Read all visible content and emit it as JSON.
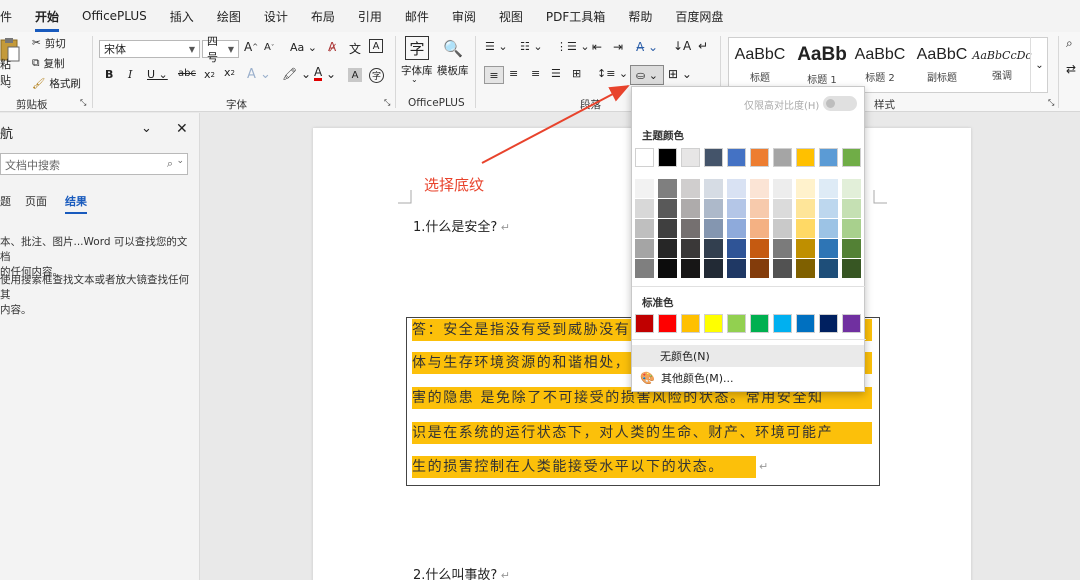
{
  "menu": {
    "items": [
      "件",
      "开始",
      "OfficePLUS",
      "插入",
      "绘图",
      "设计",
      "布局",
      "引用",
      "邮件",
      "审阅",
      "视图",
      "PDF工具箱",
      "帮助",
      "百度网盘"
    ]
  },
  "ribbon": {
    "clipboard": {
      "paste": "粘贴",
      "cut": "剪切",
      "copy": "复制",
      "format_painter": "格式刷",
      "label": "剪贴板"
    },
    "font": {
      "name": "宋体",
      "size": "四号",
      "label": "字体"
    },
    "officeplus": {
      "font_lib": "字体库",
      "template_lib": "模板库",
      "label": "OfficePLUS"
    },
    "paragraph": {
      "label": "段落"
    },
    "styles": {
      "label": "样式",
      "items": [
        {
          "sample": "AaBbC",
          "name": "标题"
        },
        {
          "sample": "AaBb",
          "name": "标题 1"
        },
        {
          "sample": "AaBbC",
          "name": "标题 2"
        },
        {
          "sample": "AaBbC",
          "name": "副标题"
        },
        {
          "sample": "AaBbCcDc",
          "name": "强调"
        }
      ]
    }
  },
  "nav": {
    "title": "航",
    "search_placeholder": "文档中搜索",
    "tabs": [
      "题",
      "页面",
      "结果"
    ],
    "text1": [
      "本、批注、图片...Word 可以查找您的文档",
      "的任何内容。"
    ],
    "text2": [
      "使用搜索框查找文本或者放大镜查找任何其",
      "内容。"
    ]
  },
  "doc": {
    "q1": "1.什么是安全?",
    "answer_lines": [
      "答：安全是指没有受到威胁没有危险、危害、损失。人类的整",
      "体与生存环境资源的和谐相处，互相不伤害，不存在危险、危",
      "害的隐患  是免除了不可接受的损害风险的状态。常用安全知",
      "识是在系统的运行状态下，对人类的生命、财产、环境可能产",
      "生的损害控制在人类能接受水平以下的状态。"
    ],
    "q2": "2.什么叫事故?"
  },
  "annotation": {
    "text": "选择底纹"
  },
  "shading_dropdown": {
    "contrast_label": "仅限高对比度(H)",
    "theme_label": "主题颜色",
    "standard_label": "标准色",
    "no_color": "无颜色(N)",
    "more_colors": "其他颜色(M)...",
    "theme_top": [
      "#ffffff",
      "#000000",
      "#e7e6e6",
      "#44546a",
      "#4472c4",
      "#ed7d31",
      "#a5a5a5",
      "#ffc000",
      "#5b9bd5",
      "#70ad47"
    ],
    "theme_shades": [
      [
        "#f2f2f2",
        "#7f7f7f",
        "#d0cece",
        "#d6dce4",
        "#d9e2f3",
        "#fbe4d5",
        "#ededed",
        "#fff2cc",
        "#deebf6",
        "#e2efd9"
      ],
      [
        "#d8d8d8",
        "#595959",
        "#aeabab",
        "#adb9ca",
        "#b4c6e7",
        "#f7caac",
        "#dbdbdb",
        "#fee599",
        "#bdd7ee",
        "#c5e0b3"
      ],
      [
        "#bfbfbf",
        "#3f3f3f",
        "#757070",
        "#8496b0",
        "#8eaadb",
        "#f4b183",
        "#c9c9c9",
        "#ffd965",
        "#9cc3e5",
        "#a8d08d"
      ],
      [
        "#a5a5a5",
        "#262626",
        "#3a3838",
        "#323f4f",
        "#2f5496",
        "#c55a11",
        "#7b7b7b",
        "#bf8f00",
        "#2e75b5",
        "#538135"
      ],
      [
        "#7f7f7f",
        "#0c0c0c",
        "#171616",
        "#222a35",
        "#1f3864",
        "#833c0b",
        "#525252",
        "#7f6000",
        "#1e4e79",
        "#375623"
      ]
    ],
    "standard": [
      "#c00000",
      "#ff0000",
      "#ffc000",
      "#ffff00",
      "#92d050",
      "#00b050",
      "#00b0f0",
      "#0070c0",
      "#002060",
      "#7030a0"
    ]
  }
}
